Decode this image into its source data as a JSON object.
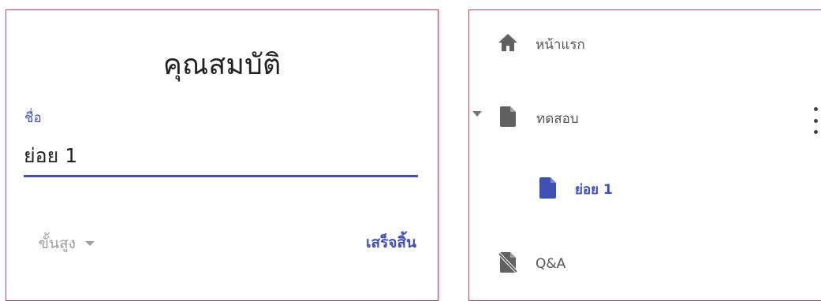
{
  "properties": {
    "title": "คุณสมบัติ",
    "name_label": "ชื่อ",
    "name_value": "ย่อย 1",
    "advanced_label": "ขั้นสูง",
    "done_label": "เสร็จสิ้น"
  },
  "navigation": {
    "items": [
      {
        "label": "หน้าแรก",
        "icon": "home-icon"
      },
      {
        "label": "ทดสอบ",
        "icon": "page-icon",
        "expanded": true
      },
      {
        "label": "ย่อย 1",
        "icon": "page-icon",
        "selected": true
      },
      {
        "label": "Q&A",
        "icon": "hidden-page-icon"
      }
    ]
  },
  "colors": {
    "accent": "#3f51b5",
    "panel_border": "#b14a6b",
    "icon_gray": "#616161"
  }
}
